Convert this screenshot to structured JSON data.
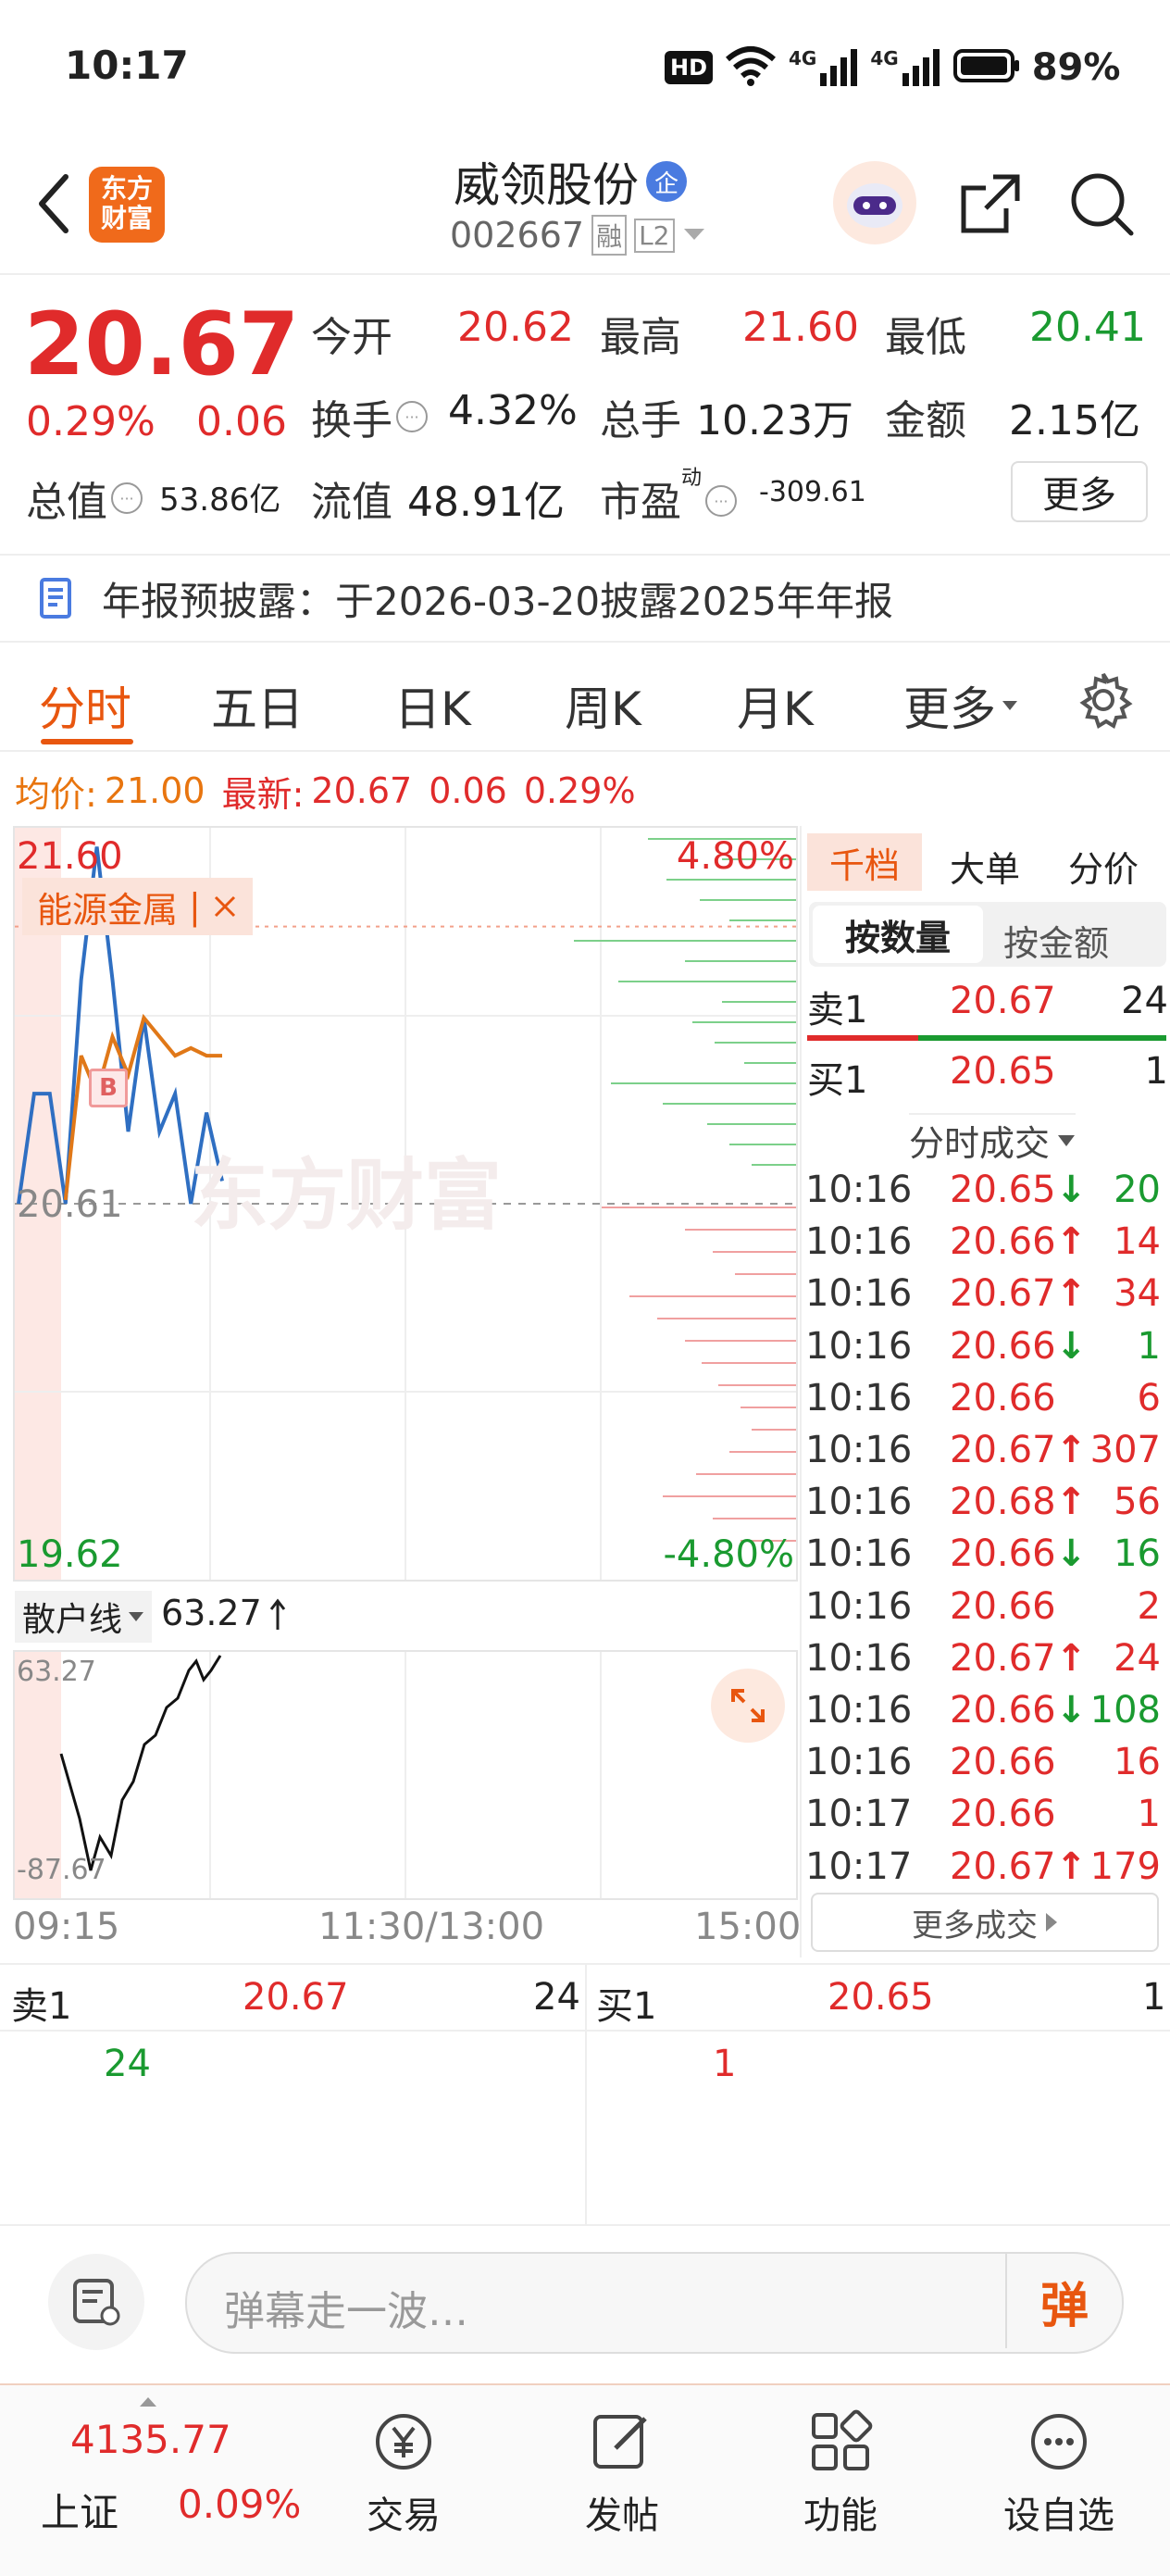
{
  "status_bar": {
    "time": "10:17",
    "network_hd": "HD",
    "net1": "4G",
    "net2": "4G",
    "battery": "89%"
  },
  "header": {
    "logo_text": "东方财富",
    "stock_name": "威领股份",
    "stock_badge": "企",
    "stock_code": "002667",
    "tag_margin": "融",
    "tag_level": "L2"
  },
  "quote": {
    "price": "20.67",
    "change_pct": "0.29%",
    "change": "0.06",
    "open_label": "今开",
    "open": "20.62",
    "high_label": "最高",
    "high": "21.60",
    "low_label": "最低",
    "low": "20.41",
    "turnover_label": "换手",
    "turnover": "4.32%",
    "volume_label": "总手",
    "volume": "10.23万",
    "amount_label": "金额",
    "amount": "2.15亿",
    "mcap_label": "总值",
    "mcap": "53.86亿",
    "float_label": "流值",
    "float_mcap": "48.91亿",
    "pe_label": "市盈",
    "pe_sup": "动",
    "pe": "-309.61",
    "more_button": "更多"
  },
  "notice": {
    "text": "年报预披露：于2026-03-20披露2025年年报"
  },
  "tabs": [
    "分时",
    "五日",
    "日K",
    "周K",
    "月K",
    "更多"
  ],
  "chart_info": {
    "avg_label": "均价:",
    "avg": "21.00",
    "latest_label": "最新:",
    "latest": "20.67",
    "chg": "0.06",
    "pct": "0.29%"
  },
  "chart": {
    "y_top": "21.60",
    "y_mid": "20.61",
    "y_bot": "19.62",
    "pct_top": "4.80%",
    "pct_bot": "-4.80%",
    "sector_tag": "能源金属",
    "watermark": "东方财富",
    "b_marker": "B"
  },
  "sub_chart": {
    "selector": "散户线",
    "value": "63.27",
    "y_top": "63.27",
    "y_bot": "-87.67"
  },
  "x_axis": {
    "start": "09:15",
    "mid": "11:30/13:00",
    "end": "15:00"
  },
  "chart_data": {
    "type": "line",
    "x": [
      "09:15",
      "09:20",
      "09:25",
      "09:30",
      "09:35",
      "09:40",
      "09:45",
      "09:50",
      "09:55",
      "10:00",
      "10:05",
      "10:10",
      "10:15",
      "10:17"
    ],
    "ylim": [
      19.62,
      21.6
    ],
    "series": [
      {
        "values": [
          20.61,
          20.9,
          20.9,
          20.61,
          21.2,
          21.55,
          21.2,
          20.8,
          21.1,
          20.8,
          20.9,
          20.61,
          20.85,
          20.67
        ]
      },
      {
        "values": [
          null,
          null,
          null,
          20.62,
          21.0,
          20.9,
          21.05,
          20.95,
          21.1,
          21.05,
          21.0,
          21.02,
          21.0,
          21.0
        ]
      }
    ]
  },
  "order_panel": {
    "tabs": [
      "千档",
      "大单",
      "分价"
    ],
    "sub_tabs": [
      "按数量",
      "按金额"
    ],
    "sell1_label": "卖1",
    "sell1_price": "20.67",
    "sell1_vol": "24",
    "buy1_label": "买1",
    "buy1_price": "20.65",
    "buy1_vol": "1",
    "trades_title": "分时成交",
    "trades": [
      {
        "t": "10:16",
        "p": "20.65",
        "d": "down",
        "v": "20"
      },
      {
        "t": "10:16",
        "p": "20.66",
        "d": "up",
        "v": "14"
      },
      {
        "t": "10:16",
        "p": "20.67",
        "d": "up",
        "v": "34"
      },
      {
        "t": "10:16",
        "p": "20.66",
        "d": "down",
        "v": "1"
      },
      {
        "t": "10:16",
        "p": "20.66",
        "d": "",
        "v": "6"
      },
      {
        "t": "10:16",
        "p": "20.67",
        "d": "up",
        "v": "307"
      },
      {
        "t": "10:16",
        "p": "20.68",
        "d": "up",
        "v": "56"
      },
      {
        "t": "10:16",
        "p": "20.66",
        "d": "down",
        "v": "16"
      },
      {
        "t": "10:16",
        "p": "20.66",
        "d": "",
        "v": "2"
      },
      {
        "t": "10:16",
        "p": "20.67",
        "d": "up",
        "v": "24"
      },
      {
        "t": "10:16",
        "p": "20.66",
        "d": "down",
        "v": "108"
      },
      {
        "t": "10:16",
        "p": "20.66",
        "d": "",
        "v": "16"
      },
      {
        "t": "10:17",
        "p": "20.66",
        "d": "",
        "v": "1"
      },
      {
        "t": "10:17",
        "p": "20.67",
        "d": "up",
        "v": "179"
      }
    ],
    "more_trades": "更多成交"
  },
  "queue": {
    "sell_label": "卖1",
    "sell_price": "20.67",
    "sell_vol": "24",
    "sell_detail": "24",
    "buy_label": "买1",
    "buy_price": "20.65",
    "buy_vol": "1",
    "buy_detail": "1"
  },
  "comment": {
    "placeholder": "弹幕走一波…",
    "send_label": "弹"
  },
  "bottom_nav": {
    "index_value": "4135.77",
    "index_name": "上证",
    "index_pct": "0.09%",
    "items": [
      "交易",
      "发帖",
      "功能",
      "设自选"
    ]
  }
}
